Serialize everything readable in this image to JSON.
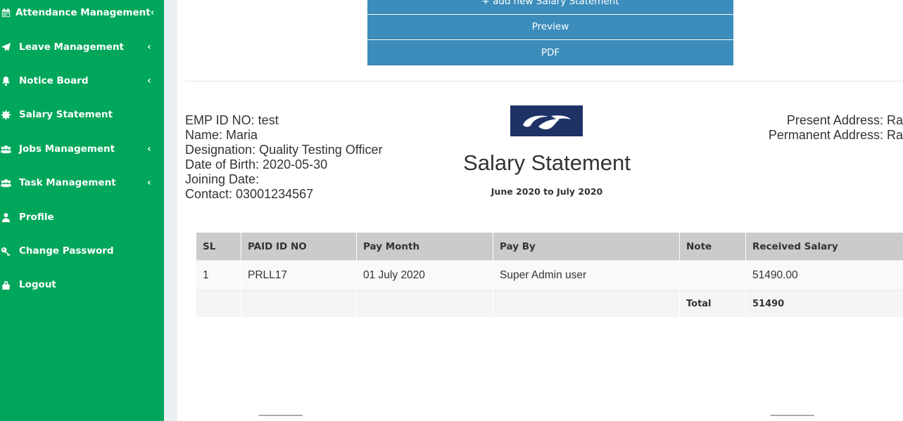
{
  "sidebar": {
    "items": [
      {
        "label": "Attendance Management",
        "icon": "calendar-icon",
        "has_submenu": true
      },
      {
        "label": "Leave Management",
        "icon": "paper-plane-icon",
        "has_submenu": true
      },
      {
        "label": "Notice Board",
        "icon": "bell-icon",
        "has_submenu": true
      },
      {
        "label": "Salary Statement",
        "icon": "gear-icon",
        "has_submenu": false
      },
      {
        "label": "Jobs Management",
        "icon": "users-icon",
        "has_submenu": true
      },
      {
        "label": "Task Management",
        "icon": "users-icon",
        "has_submenu": true
      },
      {
        "label": "Profile",
        "icon": "user-icon",
        "has_submenu": false
      },
      {
        "label": "Change Password",
        "icon": "key-icon",
        "has_submenu": false
      },
      {
        "label": "Logout",
        "icon": "lock-icon",
        "has_submenu": false
      }
    ],
    "chevron": "‹"
  },
  "actions": {
    "add_label": "+ add new Salary Statement",
    "preview_label": "Preview",
    "pdf_label": "PDF"
  },
  "employee": {
    "emp_id": "EMP ID NO: test",
    "name": "Name: Maria",
    "designation": "Designation: Quality Testing Officer",
    "dob": "Date of Birth: 2020-05-30",
    "joining": "Joining Date:",
    "contact": "Contact: 03001234567",
    "present_address": "Present Address: Rawalpindi",
    "permanent_address": "Permanent Address: Rawalpindi"
  },
  "statement": {
    "title": "Salary Statement",
    "period": "June 2020 to July 2020"
  },
  "table": {
    "headers": [
      "SL",
      "PAID ID NO",
      "Pay Month",
      "Pay By",
      "Note",
      "Received Salary"
    ],
    "rows": [
      [
        "1",
        "PRLL17",
        "01 July 2020",
        "Super Admin user",
        "",
        "51490.00"
      ]
    ],
    "total_label": "Total",
    "total_value": "51490"
  },
  "signatures": {
    "left_line": "---------------------",
    "right_line": "---------------------"
  },
  "colors": {
    "sidebar": "#00a65a",
    "button": "#3c8dbc",
    "logo_bg": "#1f3266",
    "table_header": "#cbcbcb"
  }
}
